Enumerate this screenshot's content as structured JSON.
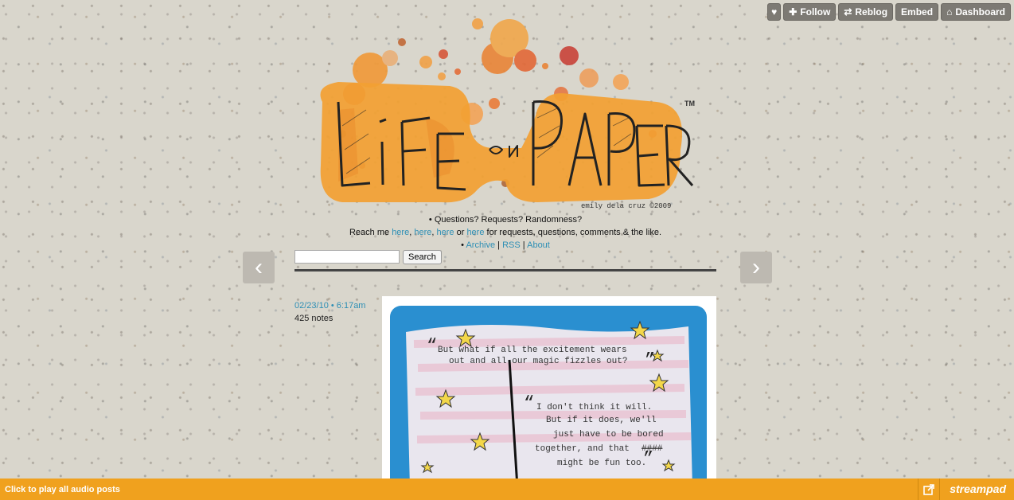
{
  "topbar": {
    "like_icon": "heart-icon",
    "follow_label": "Follow",
    "reblog_label": "Reblog",
    "embed_label": "Embed",
    "dashboard_label": "Dashboard"
  },
  "header": {
    "logo_text": "LIFE ON PAPER",
    "trademark": "TM",
    "credit": "emily dela cruz ©2009"
  },
  "info": {
    "line1": "• Questions? Requests? Randomness?",
    "reach_prefix": "Reach me ",
    "link1": "here",
    "sep1": ", ",
    "link2": "here",
    "sep2": ", ",
    "link3": "here",
    "sep3": " or ",
    "link4": "here",
    "reach_suffix": " for requests, questions, comments & the like.",
    "bullet": "• ",
    "archive": "Archive",
    "divider1": " | ",
    "rss": "RSS",
    "divider2": " | ",
    "about": "About"
  },
  "search": {
    "button_label": "Search",
    "value": ""
  },
  "nav": {
    "prev_glyph": "‹",
    "next_glyph": "›"
  },
  "post": {
    "date": "02/23/10 • 6:17am",
    "notes": "425 notes",
    "quote1_line1": "But what if all the excitement wears",
    "quote1_line2": "out and all our magic fizzles out?",
    "quote2_line1": "I don't think it will.",
    "quote2_line2": "But if it does, we'll",
    "quote2_line3": "just have to be bored",
    "quote2_line4": "together, and that",
    "quote2_struck": "####",
    "quote2_line5": "might be fun too."
  },
  "audiobar": {
    "play_label": "Click to play all audio posts",
    "brand": "streampad"
  },
  "colors": {
    "accent": "#2e8fb5",
    "audiobar": "#f0a11e",
    "logo_orange": "#f2a033",
    "card_blue": "#2a8fd0"
  }
}
